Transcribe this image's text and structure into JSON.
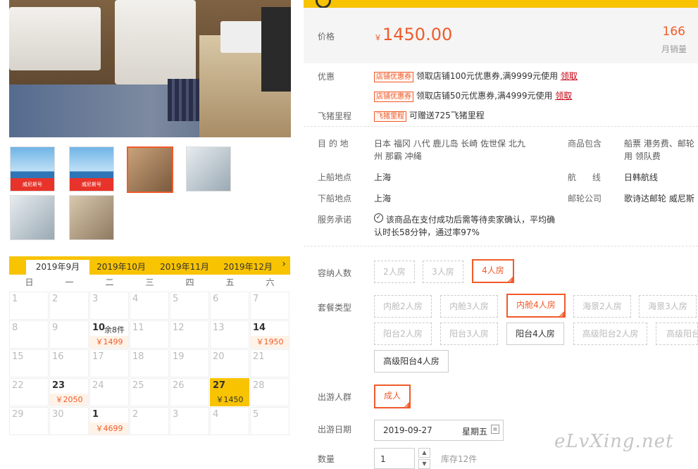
{
  "gallery": {
    "thumbs": [
      {
        "kind": "ship",
        "caption": "威尼斯号"
      },
      {
        "kind": "ship",
        "caption": "威尼斯号"
      },
      {
        "kind": "room",
        "caption": ""
      },
      {
        "kind": "cab",
        "caption": ""
      },
      {
        "kind": "cab",
        "caption": ""
      },
      {
        "kind": "lounge",
        "caption": ""
      }
    ]
  },
  "calendar": {
    "tabs": [
      "2019年9月",
      "2019年10月",
      "2019年11月",
      "2019年12月"
    ],
    "active_tab": 0,
    "weekdays": [
      "日",
      "一",
      "二",
      "三",
      "四",
      "五",
      "六"
    ],
    "weeks": [
      [
        {
          "d": "1"
        },
        {
          "d": "2"
        },
        {
          "d": "3"
        },
        {
          "d": "4"
        },
        {
          "d": "5"
        },
        {
          "d": "6"
        },
        {
          "d": "7"
        }
      ],
      [
        {
          "d": "8"
        },
        {
          "d": "9"
        },
        {
          "d": "10",
          "rem": "余8件",
          "price": "￥1499"
        },
        {
          "d": "11"
        },
        {
          "d": "12"
        },
        {
          "d": "13"
        },
        {
          "d": "14",
          "price": "￥1950"
        }
      ],
      [
        {
          "d": "15"
        },
        {
          "d": "16"
        },
        {
          "d": "17"
        },
        {
          "d": "18"
        },
        {
          "d": "19"
        },
        {
          "d": "20"
        },
        {
          "d": "21"
        }
      ],
      [
        {
          "d": "22"
        },
        {
          "d": "23",
          "price": "￥2050"
        },
        {
          "d": "24"
        },
        {
          "d": "25"
        },
        {
          "d": "26"
        },
        {
          "d": "27",
          "price": "￥1450",
          "selected": true
        },
        {
          "d": "28"
        }
      ],
      [
        {
          "d": "29"
        },
        {
          "d": "30"
        },
        {
          "d": "1",
          "price": "￥4699"
        },
        {
          "d": "2"
        },
        {
          "d": "3"
        },
        {
          "d": "4"
        },
        {
          "d": "5"
        }
      ]
    ]
  },
  "price": {
    "label": "价格",
    "currency": "￥",
    "amount": "1450.00",
    "sales": "166",
    "sales_label": "月销量"
  },
  "promo": {
    "label": "优惠",
    "rows": [
      {
        "tag": "店铺优惠券",
        "text": "领取店铺100元优惠券,满9999元使用",
        "link": "领取"
      },
      {
        "tag": "店铺优惠券",
        "text": "领取店铺50元优惠券,满4999元使用",
        "link": "领取"
      }
    ],
    "mileage_label": "飞猪里程",
    "mileage_tag": "飞猪里程",
    "mileage_text": "可赠送725飞猪里程"
  },
  "info": {
    "dest_label": "目 的 地",
    "dest_line1": "日本  福冈  八代  鹿儿岛  长崎  佐世保  北九",
    "dest_line2": "州  那霸  冲绳",
    "incl_label": "商品包含",
    "incl_line1": "船票  港务费、邮轮",
    "incl_line2": "用  领队费",
    "board_label": "上船地点",
    "board": "上海",
    "route_label": "航      线",
    "route": "日韩航线",
    "alight_label": "下船地点",
    "alight": "上海",
    "company_label": "邮轮公司",
    "company": "歌诗达邮轮  威尼斯",
    "service_label": "服务承诺",
    "service_line1": "该商品在支付成功后需等待卖家确认，平均确",
    "service_line2": "认时长58分钟，通过率97%"
  },
  "capacity": {
    "label": "容纳人数",
    "options": [
      "2人房",
      "3人房",
      "4人房"
    ]
  },
  "package": {
    "label": "套餐类型",
    "options": [
      "内舱2人房",
      "内舱3人房",
      "内舱4人房",
      "海景2人房",
      "海景3人房",
      "阳台2人房",
      "阳台3人房",
      "阳台4人房",
      "高级阳台2人房",
      "高级阳台",
      "高级阳台4人房"
    ]
  },
  "group": {
    "label": "出游人群",
    "option": "成人"
  },
  "date": {
    "label": "出游日期",
    "value": "2019-09-27",
    "weekday": "星期五"
  },
  "quantity": {
    "label": "数量",
    "value": "1",
    "stock": "库存12件"
  },
  "watermark": "eLvXing.net"
}
